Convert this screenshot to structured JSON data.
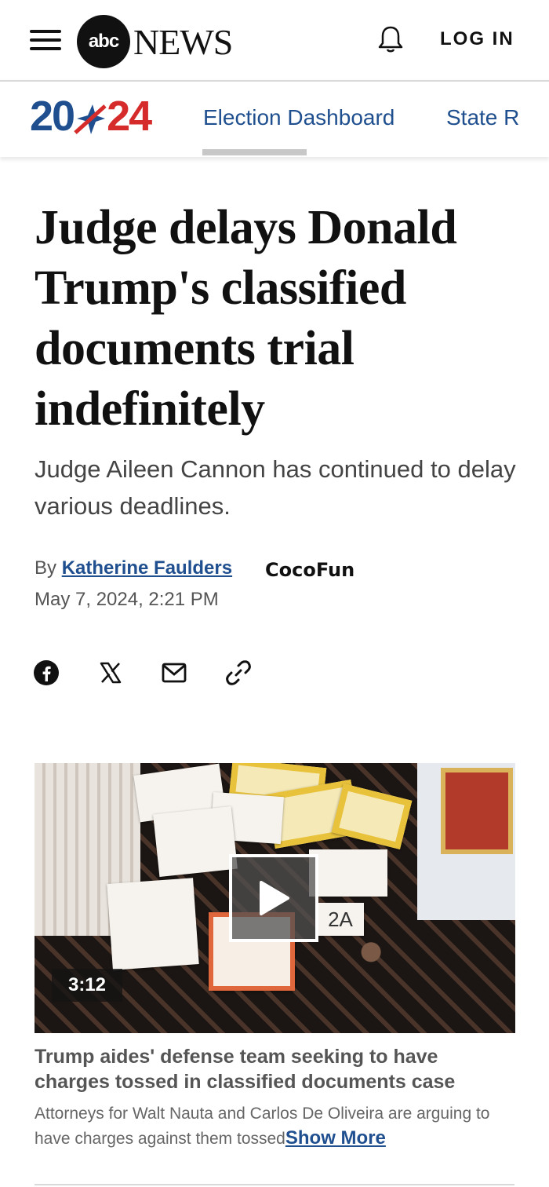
{
  "header": {
    "logo_abc": "abc",
    "logo_news": "NEWS",
    "login_label": "LOG IN"
  },
  "subnav": {
    "logo_left": "20",
    "logo_right": "24",
    "tabs": [
      {
        "label": "Election Dashboard",
        "active": true
      },
      {
        "label": "State R",
        "active": false
      }
    ]
  },
  "article": {
    "headline": "Judge delays Donald Trump's classified documents trial indefinitely",
    "subhead": "Judge Aileen Cannon has continued to delay various deadlines.",
    "by_prefix": "By",
    "author": "Katherine Faulders",
    "date": "May 7, 2024, 2:21 PM"
  },
  "watermark": "CocoFun",
  "share": {
    "icons": [
      "facebook-icon",
      "x-icon",
      "email-icon",
      "link-icon"
    ]
  },
  "video": {
    "duration": "3:12",
    "exhibit_label": "2A",
    "title": "Trump aides' defense team seeking to have charges tossed in classified documents case",
    "description": "Attorneys for Walt Nauta and Carlos De Oliveira are arguing to have charges against them tossed",
    "show_more": "Show More"
  },
  "colors": {
    "brand_blue": "#1f4f8f",
    "brand_red": "#d62b2b",
    "text_dark": "#111111",
    "text_muted": "#555555"
  }
}
